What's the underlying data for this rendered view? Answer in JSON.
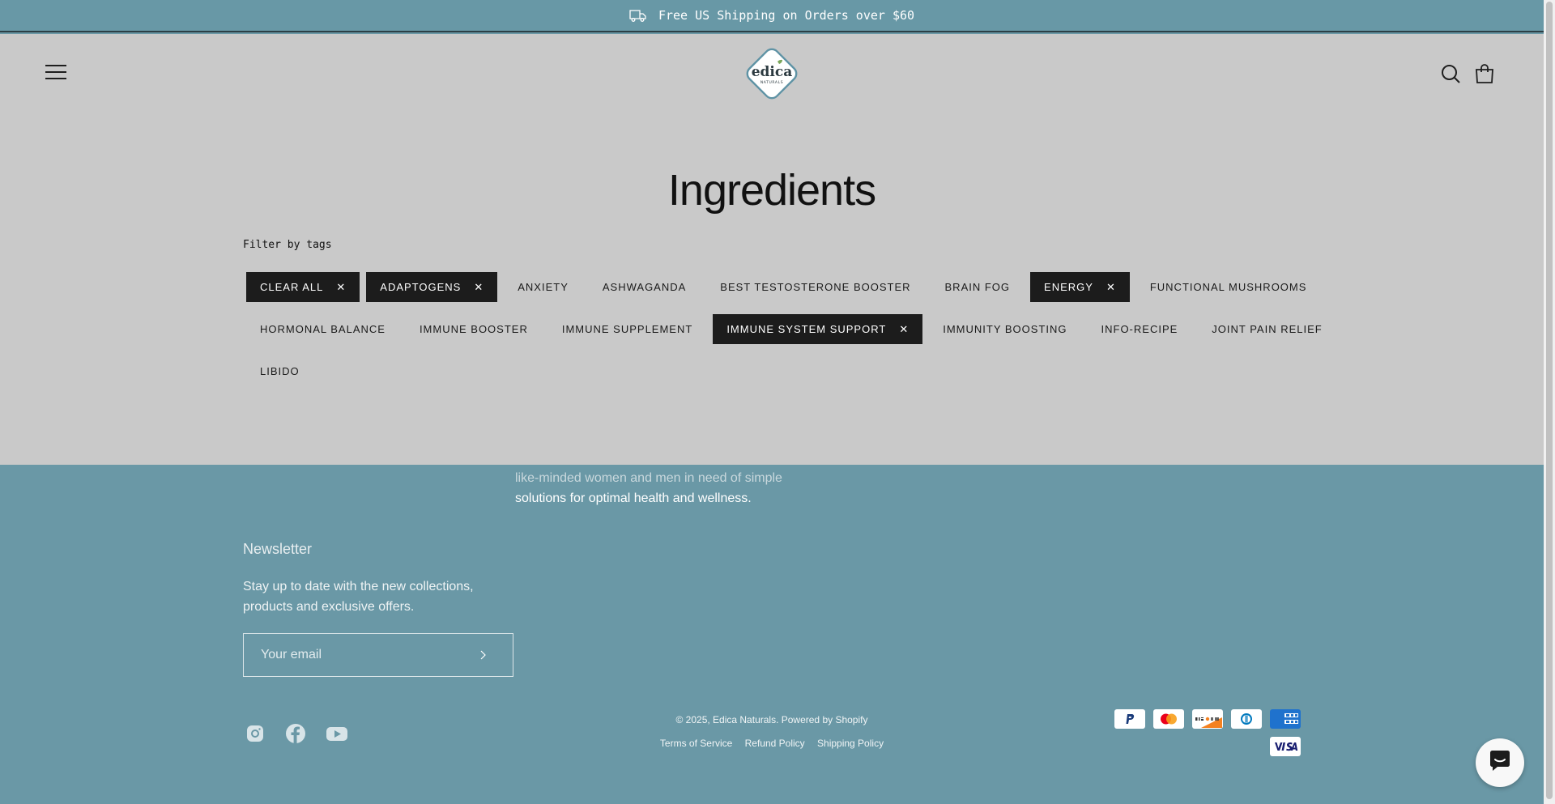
{
  "announcement": {
    "text": "Free US Shipping on Orders over $60",
    "icon": "truck-icon"
  },
  "header": {
    "menu_icon": "hamburger-icon",
    "logo_text": "edica",
    "logo_sub": "NATURALS",
    "search_icon": "search-icon",
    "cart_icon": "bag-icon"
  },
  "page": {
    "title": "Ingredients",
    "filter_label": "Filter by tags"
  },
  "tags": {
    "rows": [
      [
        {
          "label": "CLEAR ALL",
          "active": true
        },
        {
          "label": "ADAPTOGENS",
          "active": true
        },
        {
          "label": "ANXIETY",
          "active": false
        },
        {
          "label": "ASHWAGANDA",
          "active": false
        },
        {
          "label": "BEST TESTOSTERONE BOOSTER",
          "active": false
        },
        {
          "label": "BRAIN FOG",
          "active": false
        },
        {
          "label": "ENERGY",
          "active": true
        },
        {
          "label": "FUNCTIONAL MUSHROOMS",
          "active": false
        }
      ],
      [
        {
          "label": "HORMONAL BALANCE",
          "active": false
        },
        {
          "label": "IMMUNE BOOSTER",
          "active": false
        },
        {
          "label": "IMMUNE SUPPLEMENT",
          "active": false
        },
        {
          "label": "IMMUNE SYSTEM SUPPORT",
          "active": true
        },
        {
          "label": "IMMUNITY BOOSTING",
          "active": false
        },
        {
          "label": "INFO-RECIPE",
          "active": false
        },
        {
          "label": "JOINT PAIN RELIEF",
          "active": false
        }
      ],
      [
        {
          "label": "LIBIDO",
          "active": false
        }
      ]
    ],
    "remove_glyph": "✕"
  },
  "footer": {
    "about_line1": "like-minded women and men in need of simple",
    "about_line2": "solutions for optimal health and wellness.",
    "newsletter_title": "Newsletter",
    "newsletter_text": "Stay up to date with the new collections, products and exclusive offers.",
    "email_placeholder": "Your email",
    "copyright": "© 2025, Edica Naturals. Powered by Shopify",
    "policies": [
      "Terms of Service",
      "Refund Policy",
      "Shipping Policy"
    ],
    "socials": [
      "instagram-icon",
      "facebook-icon",
      "youtube-icon"
    ],
    "payments": [
      "PayPal",
      "Mastercard",
      "Discover",
      "Diners Club",
      "American Express",
      "Visa"
    ]
  },
  "colors": {
    "teal": "#6898a6",
    "overlay": "#c9c9c9",
    "tag_active": "#1c1c1c"
  }
}
